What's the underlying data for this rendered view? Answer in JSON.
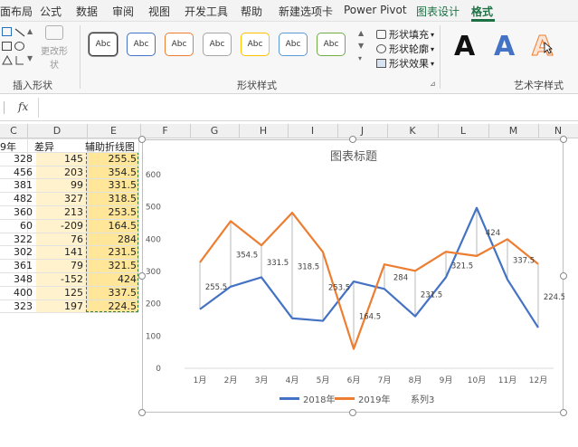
{
  "ribbon": {
    "tabs": [
      {
        "label": "页面布局",
        "display": "面布局"
      },
      {
        "label": "公式"
      },
      {
        "label": "数据"
      },
      {
        "label": "审阅"
      },
      {
        "label": "视图"
      },
      {
        "label": "开发工具"
      },
      {
        "label": "帮助"
      },
      {
        "label": "新建选项卡"
      },
      {
        "label": "Power Pivot"
      },
      {
        "label": "图表设计"
      },
      {
        "label": "格式"
      }
    ],
    "active_tab": "格式",
    "groups": {
      "insert_shapes": {
        "label": "插入形状",
        "change_shape_label": "更改形状"
      },
      "shape_styles": {
        "label": "形状样式",
        "preset_label": "Abc",
        "preset_borders": [
          "#333333",
          "#4472c4",
          "#ed7d31",
          "#a5a5a5",
          "#ffc000",
          "#5b9bd5",
          "#70ad47"
        ],
        "fill_label": "形状填充",
        "outline_label": "形状轮廓",
        "effects_label": "形状效果"
      },
      "wordart_styles": {
        "label": "艺术字样式",
        "sample": "A"
      }
    }
  },
  "formula_bar": {
    "fx_label": "fx",
    "value": ""
  },
  "sheet": {
    "columns": [
      "C",
      "D",
      "E",
      "F",
      "G",
      "H",
      "I",
      "J",
      "K",
      "L",
      "M",
      "N"
    ],
    "headers": {
      "c": "9年",
      "d": "差异",
      "e": "辅助折线图"
    },
    "rows": [
      {
        "c": "328",
        "d": "145",
        "e": "255.5"
      },
      {
        "c": "456",
        "d": "203",
        "e": "354.5"
      },
      {
        "c": "381",
        "d": "99",
        "e": "331.5"
      },
      {
        "c": "482",
        "d": "327",
        "e": "318.5"
      },
      {
        "c": "360",
        "d": "213",
        "e": "253.5"
      },
      {
        "c": "60",
        "d": "-209",
        "e": "164.5"
      },
      {
        "c": "322",
        "d": "76",
        "e": "284"
      },
      {
        "c": "302",
        "d": "141",
        "e": "231.5"
      },
      {
        "c": "361",
        "d": "79",
        "e": "321.5"
      },
      {
        "c": "348",
        "d": "-152",
        "e": "424"
      },
      {
        "c": "400",
        "d": "125",
        "e": "337.5"
      },
      {
        "c": "323",
        "d": "197",
        "e": "224.5"
      }
    ],
    "highlight_color": "#ffe699",
    "band_color": "#fff2cc"
  },
  "chart_data": {
    "type": "line",
    "title": "图表标题",
    "categories": [
      "1月",
      "2月",
      "3月",
      "4月",
      "5月",
      "6月",
      "7月",
      "8月",
      "9月",
      "10月",
      "11月",
      "12月"
    ],
    "ylim": [
      0,
      600
    ],
    "yticks": [
      0,
      100,
      200,
      300,
      400,
      500,
      600
    ],
    "grid": false,
    "legend_position": "bottom",
    "series": [
      {
        "name": "2018年",
        "color": "#4472c4",
        "values": [
          183,
          253,
          282,
          155,
          147,
          269,
          246,
          161,
          282,
          497,
          275,
          126
        ]
      },
      {
        "name": "2019年",
        "color": "#ed7d31",
        "values": [
          328,
          456,
          381,
          482,
          360,
          60,
          322,
          302,
          361,
          348,
          400,
          323
        ]
      },
      {
        "name": "系列3",
        "color": "none",
        "values": [
          255.5,
          354.5,
          331.5,
          318.5,
          253.5,
          164.5,
          284,
          231.5,
          321.5,
          424,
          337.5,
          224.5
        ]
      }
    ],
    "data_labels": [
      "255.5",
      "354.5",
      "331.5",
      "318.5",
      "253.5",
      "164.5",
      "284",
      "231.5",
      "321.5",
      "424",
      "337.5",
      "224.5"
    ]
  }
}
